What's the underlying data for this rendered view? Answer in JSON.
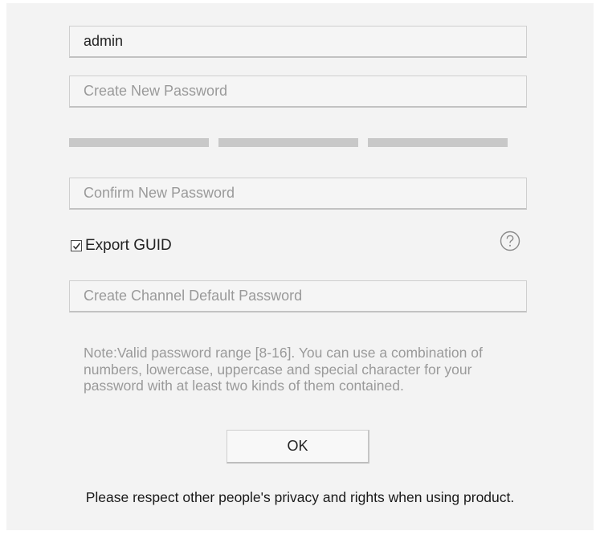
{
  "form": {
    "username_value": "admin",
    "new_password_placeholder": "Create New Password",
    "confirm_password_placeholder": "Confirm New Password",
    "export_guid_label": "Export GUID",
    "export_guid_checked": true,
    "channel_password_placeholder": "Create Channel Default Password",
    "note": "Note:Valid password range [8-16]. You can use a combination of numbers, lowercase, uppercase and special character for your password with at least two kinds of them contained.",
    "ok_label": "OK",
    "help_icon": "question-circle-icon",
    "checkbox_icon": "checkmark-icon"
  },
  "footer": {
    "privacy_text": "Please respect other people's privacy and rights when using product."
  },
  "colors": {
    "background": "#f3f3f3",
    "strength_bar": "#c8c8c8",
    "placeholder_text": "#9a9a9a"
  }
}
